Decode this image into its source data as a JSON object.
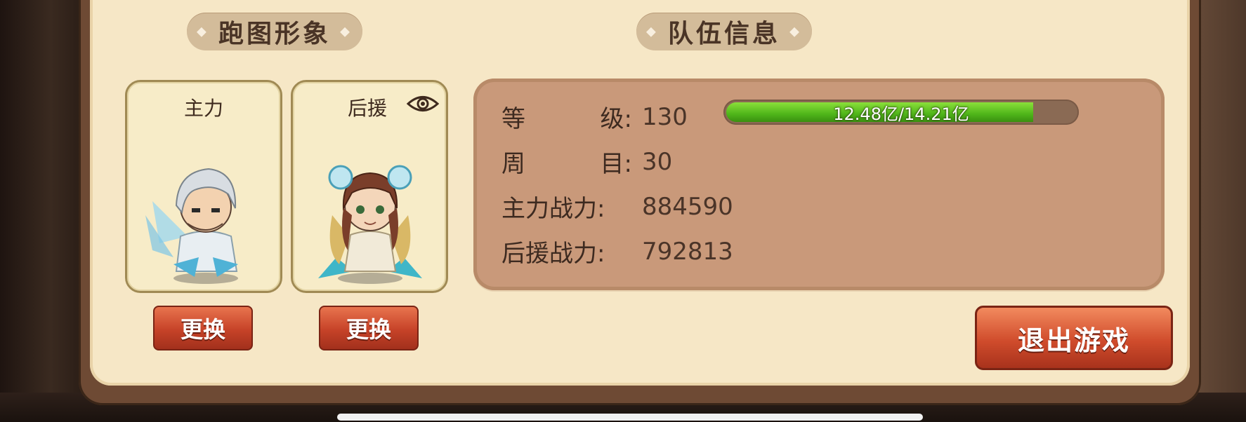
{
  "sections": {
    "avatar_title": "跑图形象",
    "team_title": "队伍信息"
  },
  "cards": {
    "main": {
      "label": "主力",
      "button": "更换"
    },
    "support": {
      "label": "后援",
      "button": "更换"
    }
  },
  "team_info": {
    "level_label_a": "等",
    "level_label_b": "级:",
    "level_value": "130",
    "exp_text": "12.48亿/14.21亿",
    "exp_fraction": 0.878,
    "cycle_label_a": "周",
    "cycle_label_b": "目:",
    "cycle_value": "30",
    "main_power_label": "主力战力:",
    "main_power_value": "884590",
    "support_power_label": "后援战力:",
    "support_power_value": "792813"
  },
  "exit_button": "退出游戏",
  "icons": {
    "view": "eye-icon",
    "diamond": "diamond-ornament-icon"
  },
  "colors": {
    "panel": "#f6e7c6",
    "info_box": "#c9997a",
    "button_red": "#c64228",
    "exp_green": "#4fb51a"
  }
}
